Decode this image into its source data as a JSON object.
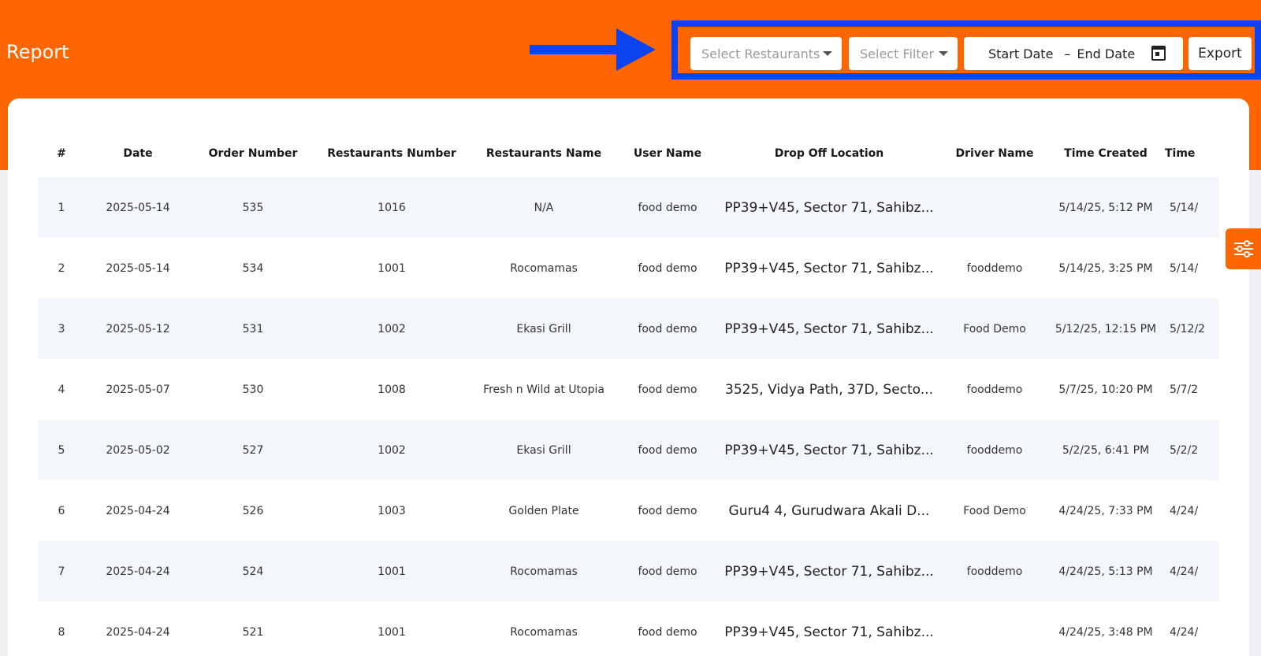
{
  "header": {
    "title": "Report",
    "controls": {
      "restaurants_placeholder": "Select Restaurants",
      "filter_placeholder": "Select Filter",
      "start_date": "Start Date",
      "date_separator": "–",
      "end_date": "End Date",
      "export_label": "Export"
    }
  },
  "table": {
    "headers": [
      "#",
      "Date",
      "Order Number",
      "Restaurants Number",
      "Restaurants Name",
      "User Name",
      "Drop Off Location",
      "Driver Name",
      "Time Created",
      "Time"
    ],
    "rows": [
      [
        "1",
        "2025-05-14",
        "535",
        "1016",
        "N/A",
        "food demo",
        "PP39+V45, Sector 71, Sahibz...",
        "",
        "5/14/25, 5:12 PM",
        "5/14/"
      ],
      [
        "2",
        "2025-05-14",
        "534",
        "1001",
        "Rocomamas",
        "food demo",
        "PP39+V45, Sector 71, Sahibz...",
        "fooddemo",
        "5/14/25, 3:25 PM",
        "5/14/"
      ],
      [
        "3",
        "2025-05-12",
        "531",
        "1002",
        "Ekasi Grill",
        "food demo",
        "PP39+V45, Sector 71, Sahibz...",
        "Food Demo",
        "5/12/25, 12:15 PM",
        "5/12/2"
      ],
      [
        "4",
        "2025-05-07",
        "530",
        "1008",
        "Fresh n Wild at Utopia",
        "food demo",
        "3525, Vidya Path, 37D, Secto...",
        "fooddemo",
        "5/7/25, 10:20 PM",
        "5/7/2"
      ],
      [
        "5",
        "2025-05-02",
        "527",
        "1002",
        "Ekasi Grill",
        "food demo",
        "PP39+V45, Sector 71, Sahibz...",
        "fooddemo",
        "5/2/25, 6:41 PM",
        "5/2/2"
      ],
      [
        "6",
        "2025-04-24",
        "526",
        "1003",
        "Golden Plate",
        "food demo",
        "Guru4 4, Gurudwara Akali D...",
        "Food Demo",
        "4/24/25, 7:33 PM",
        "4/24/"
      ],
      [
        "7",
        "2025-04-24",
        "524",
        "1001",
        "Rocomamas",
        "food demo",
        "PP39+V45, Sector 71, Sahibz...",
        "fooddemo",
        "4/24/25, 5:13 PM",
        "4/24/"
      ],
      [
        "8",
        "2025-04-24",
        "521",
        "1001",
        "Rocomamas",
        "food demo",
        "PP39+V45, Sector 71, Sahibz...",
        "",
        "4/24/25, 3:48 PM",
        "4/24/"
      ]
    ]
  },
  "colors": {
    "brand": "#ff6600",
    "highlight": "#0b43ee",
    "row_alt": "#f3f7fb"
  },
  "icons": {
    "arrow": "arrow-right-icon",
    "calendar": "calendar-icon",
    "caret": "chevron-down-icon",
    "side_tab": "sliders-icon"
  }
}
